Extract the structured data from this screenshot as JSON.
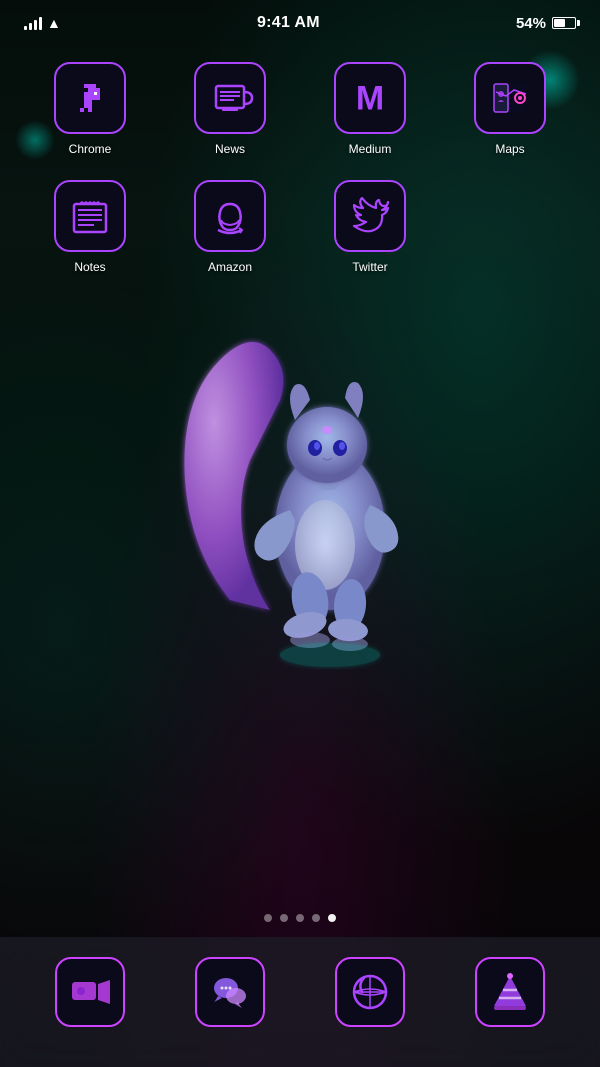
{
  "statusBar": {
    "time": "9:41 AM",
    "battery": "54%",
    "batteryFill": 54
  },
  "apps": {
    "row1": [
      {
        "id": "chrome",
        "label": "Chrome"
      },
      {
        "id": "news",
        "label": "News"
      },
      {
        "id": "medium",
        "label": "Medium"
      },
      {
        "id": "maps",
        "label": "Maps"
      }
    ],
    "row2": [
      {
        "id": "notes",
        "label": "Notes"
      },
      {
        "id": "amazon",
        "label": "Amazon"
      },
      {
        "id": "twitter",
        "label": "Twitter"
      }
    ]
  },
  "dock": [
    {
      "id": "facetime",
      "label": "FaceTime"
    },
    {
      "id": "messages",
      "label": "Messages"
    },
    {
      "id": "browser",
      "label": "Browser"
    },
    {
      "id": "vlc",
      "label": "VLC"
    }
  ],
  "pageDots": {
    "total": 5,
    "active": 4
  }
}
